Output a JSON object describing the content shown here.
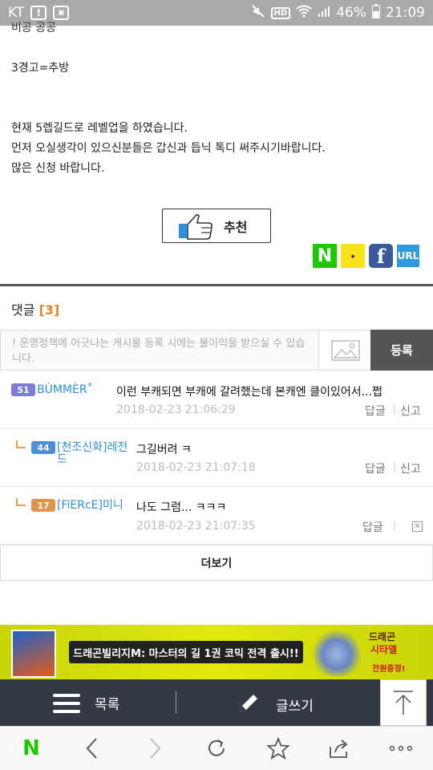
{
  "status_bar": {
    "carrier": "KT",
    "hd_badge": "HD",
    "battery": "46%",
    "time": "21:09"
  },
  "article": {
    "lines": [
      "비공 공공",
      "3경고=추방",
      "현재 5렙길드로 레벨업을 하였습니다.",
      "먼저 오실생각이 있으신분들은 갑신과 듭닉 톡디 써주시기바랍니다.",
      "많은 신청 바랍니다."
    ],
    "recommend_label": "추천"
  },
  "share": {
    "naver": "N",
    "kakao": "ㆍ",
    "facebook": "f",
    "url": "URL"
  },
  "comments_section": {
    "title": "댓글",
    "count": "[3]",
    "placeholder": "! 운영정책에 어긋나는 게시물 등록 시에는 불이익을 받으실 수 있습니다.",
    "submit_label": "등록",
    "comments": [
      {
        "level": "51",
        "level_color": "#7b7fd4",
        "nick": "BÙMMÈR˚",
        "text": "이런 부캐되면 부캐에 갈려했는데 본캐엔 클이있어서...쩝",
        "time": "2018-02-23 21:06:29",
        "reply": "답글",
        "report": "신고",
        "is_reply": false
      },
      {
        "level": "44",
        "level_color": "#4a8fd8",
        "nick": "[천조신화]레전드",
        "text": "그길버려 ㅋ",
        "time": "2018-02-23 21:07:18",
        "reply": "답글",
        "report": "신고",
        "is_reply": true
      },
      {
        "level": "17",
        "level_color": "#e0944a",
        "nick": "[FiERcE]미니",
        "text": "나도 그럼... ㅋㅋㅋ",
        "time": "2018-02-23 21:07:35",
        "reply": "답글",
        "report": "✕",
        "is_reply": true
      }
    ],
    "more_label": "더보기"
  },
  "banner": {
    "headline": "드래곤빌리지M: 마스터의 길 1권 코믹 전격 출시!!",
    "right_brand": "드래곤",
    "right_title": "시타엘",
    "right_promo": "전원증정!"
  },
  "bottom_nav": {
    "list_label": "목록",
    "write_label": "글쓰기"
  },
  "browser_bar": {
    "home": "N"
  },
  "colors": {
    "accent_orange": "#e8832a",
    "nick_blue": "#2a8fd8",
    "naver_green": "#1ec800",
    "nav_dark": "#333a45"
  }
}
